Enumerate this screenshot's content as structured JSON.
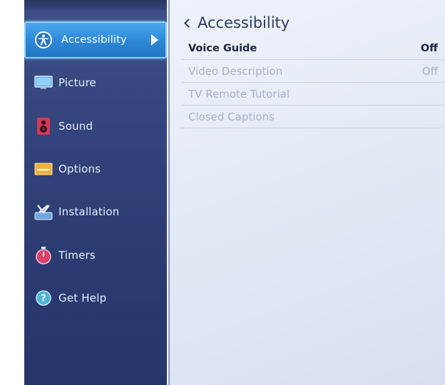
{
  "sidebar": {
    "items": [
      {
        "label": "Accessibility",
        "icon": "accessibility-icon",
        "selected": true
      },
      {
        "label": "Picture",
        "icon": "picture-icon"
      },
      {
        "label": "Sound",
        "icon": "sound-icon"
      },
      {
        "label": "Options",
        "icon": "options-icon"
      },
      {
        "label": "Installation",
        "icon": "installation-icon"
      },
      {
        "label": "Timers",
        "icon": "timers-icon"
      },
      {
        "label": "Get Help",
        "icon": "help-icon"
      }
    ]
  },
  "panel": {
    "title": "Accessibility",
    "rows": [
      {
        "label": "Voice Guide",
        "value": "Off"
      },
      {
        "label": "Video Description",
        "value": "Off"
      },
      {
        "label": "TV Remote Tutorial",
        "value": ""
      },
      {
        "label": "Closed Captions",
        "value": ""
      }
    ]
  },
  "colors": {
    "sidebar_bg": "#31427a",
    "selected_bg": "#2f8ad8",
    "panel_bg": "#e6ecf7",
    "active_text": "#1c2440",
    "dim_text": "#a9b1c3"
  }
}
